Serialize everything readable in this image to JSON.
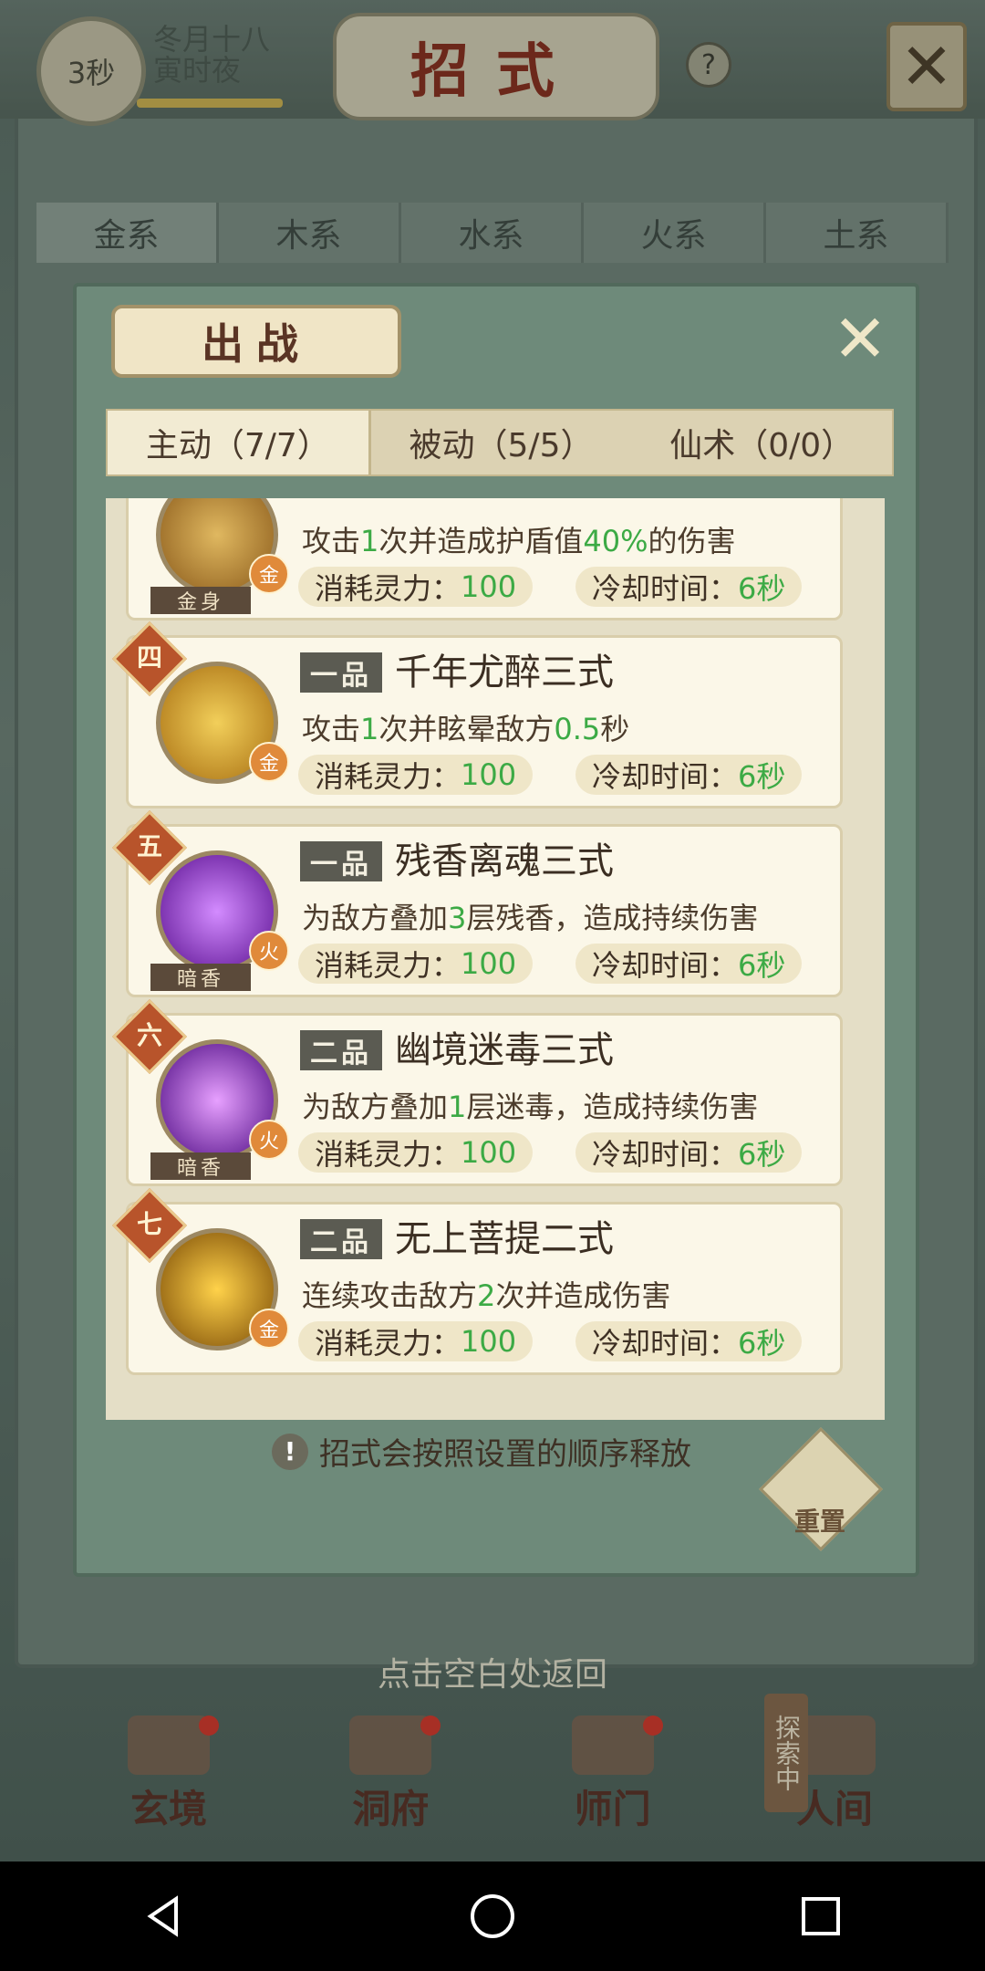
{
  "topbar": {
    "timer": "3秒",
    "date_line1": "冬月十八",
    "date_line2": "寅时夜",
    "title": "招式",
    "help_icon": "question-icon",
    "close_icon": "close-icon"
  },
  "element_tabs": [
    "金系",
    "木系",
    "水系",
    "火系",
    "土系"
  ],
  "modal": {
    "title": "出战",
    "tabs": [
      "主动（7/7）",
      "被动（5/5）",
      "仙术（0/0）"
    ],
    "cards": [
      {
        "rank": "",
        "grade": "",
        "name": "",
        "desc_pre": "攻击",
        "desc_n1": "1",
        "desc_mid": "次并造成护盾值",
        "desc_n2": "40%",
        "desc_post": "的伤害",
        "cost_label": "消耗灵力：",
        "cost": "100",
        "cd_label": "冷却时间：",
        "cd": "6秒",
        "element": "金",
        "banner": "金身",
        "icon_color": "#b58a3a"
      },
      {
        "rank": "四",
        "grade": "一品",
        "name": "千年尤醉三式",
        "desc_pre": "攻击",
        "desc_n1": "1",
        "desc_mid": "次并眩晕敌方",
        "desc_n2": "0.5",
        "desc_post": "秒",
        "cost_label": "消耗灵力：",
        "cost": "100",
        "cd_label": "冷却时间：",
        "cd": "6秒",
        "element": "金",
        "banner": "",
        "icon_color": "#c8921e"
      },
      {
        "rank": "五",
        "grade": "一品",
        "name": "残香离魂三式",
        "desc_pre": "为敌方叠加",
        "desc_n1": "3",
        "desc_mid": "层残香，造成持续伤害",
        "desc_n2": "",
        "desc_post": "",
        "cost_label": "消耗灵力：",
        "cost": "100",
        "cd_label": "冷却时间：",
        "cd": "6秒",
        "element": "火",
        "banner": "暗香",
        "icon_color": "#8a2cc0"
      },
      {
        "rank": "六",
        "grade": "二品",
        "name": "幽境迷毒三式",
        "desc_pre": "为敌方叠加",
        "desc_n1": "1",
        "desc_mid": "层迷毒，造成持续伤害",
        "desc_n2": "",
        "desc_post": "",
        "cost_label": "消耗灵力：",
        "cost": "100",
        "cd_label": "冷却时间：",
        "cd": "6秒",
        "element": "火",
        "banner": "暗香",
        "icon_color": "#7a22b0"
      },
      {
        "rank": "七",
        "grade": "二品",
        "name": "无上菩提二式",
        "desc_pre": "连续攻击敌方",
        "desc_n1": "2",
        "desc_mid": "次并造成伤害",
        "desc_n2": "",
        "desc_post": "",
        "cost_label": "消耗灵力：",
        "cost": "100",
        "cd_label": "冷却时间：",
        "cd": "6秒",
        "element": "金",
        "banner": "",
        "icon_color": "#d69a10"
      }
    ],
    "note": "招式会按照设置的顺序释放",
    "reset_label": "重置"
  },
  "back_hint": "点击空白处返回",
  "bottom_nav": [
    "玄境",
    "洞府",
    "师门",
    "人间"
  ],
  "explore_label": "探索中",
  "colors": {
    "highlight": "#3caa45",
    "title_red": "#8a2d1c"
  }
}
